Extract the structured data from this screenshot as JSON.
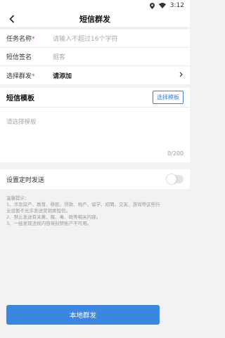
{
  "status_bar": {
    "time": "3:12"
  },
  "header": {
    "title": "短信群发"
  },
  "form": {
    "task_name": {
      "label": "任务名称",
      "required_mark": "*",
      "placeholder": "请输入不超过16个字符"
    },
    "signature": {
      "label": "短信签名",
      "value": "掘客"
    },
    "group": {
      "label": "选择群发",
      "required_mark": "*",
      "value": "请添加"
    }
  },
  "template": {
    "title": "短信模板",
    "select_button": "选择模板",
    "placeholder": "请选择模板",
    "counter": "0/200"
  },
  "schedule": {
    "label": "设置定时发送",
    "enabled": false
  },
  "tips": {
    "title": "温馨提示：",
    "lines": [
      "1、涉及房产、教育、移民、贷款、地产、留学、招聘、交友、游戏等这些行",
      "业设暂不允许发送营销类短信。",
      "2、禁止发送有关黄、赌、毒、政等相关内容。",
      "3、一经发现违规内容将封禁账户不可用。"
    ]
  },
  "send_button": {
    "label": "本地群发"
  },
  "colors": {
    "accent": "#3b86e0",
    "required": "#e23b3b"
  }
}
